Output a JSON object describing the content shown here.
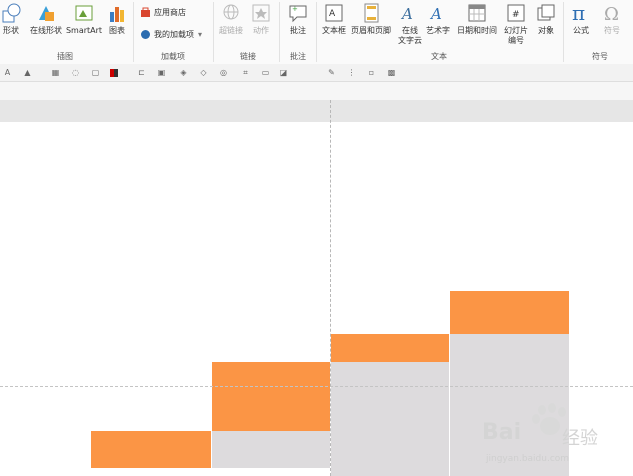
{
  "ribbon": {
    "groups": [
      {
        "label": "插图"
      },
      {
        "label": "加载项"
      },
      {
        "label": "链接"
      },
      {
        "label": "批注"
      },
      {
        "label": "文本"
      },
      {
        "label": "符号"
      }
    ],
    "buttons": {
      "shapes": "形状",
      "online_shapes": "在线形状",
      "smartart": "SmartArt",
      "chart": "图表",
      "app_store": "应用商店",
      "my_addins": "我的加载项",
      "hyperlink": "超链接",
      "action": "动作",
      "comment": "批注",
      "textbox": "文本框",
      "header_footer": "页眉和页脚",
      "word_cloud": "在线\n文字云",
      "wordart": "艺术字",
      "date_time": "日期和时间",
      "slide_number": "幻灯片\n编号",
      "object": "对象",
      "equation": "公式",
      "symbol": "符号"
    }
  },
  "watermark": {
    "brand": "Bai",
    "brand2": "经验",
    "url": "jingyan.baidu.com"
  },
  "colors": {
    "orange": "#fb9545",
    "grey": "#dddbdd"
  }
}
